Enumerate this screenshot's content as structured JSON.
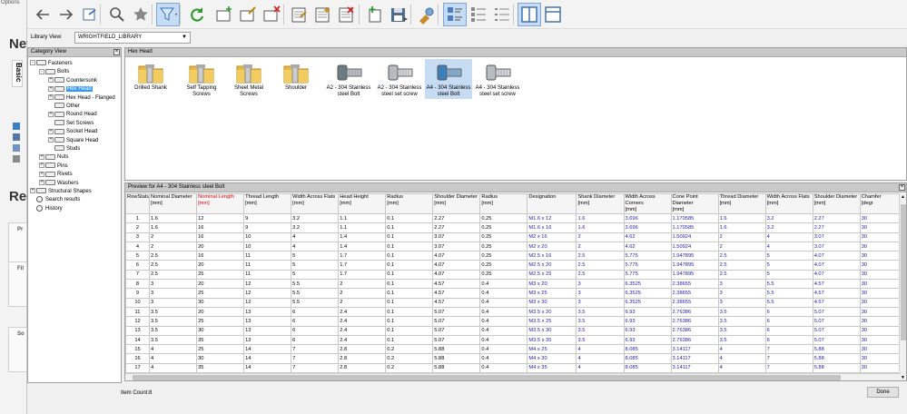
{
  "background_window": {
    "title": "Options",
    "heading_fragment": "Nev",
    "tab_label": "Basic",
    "heading_fragment_2": "Rec",
    "box_labels": [
      "Pr",
      "Fil",
      "So"
    ]
  },
  "library": {
    "label": "Library View:",
    "selected": "WRIGHTFIELD_LIBRARY"
  },
  "category_view": {
    "title": "Category View",
    "tree": [
      {
        "label": "Fasteners",
        "depth": 0,
        "expander": "-"
      },
      {
        "label": "Bolts",
        "depth": 1,
        "expander": "-"
      },
      {
        "label": "Countersunk",
        "depth": 2,
        "expander": "+"
      },
      {
        "label": "Hex Head",
        "depth": 2,
        "expander": "+",
        "selected": true
      },
      {
        "label": "Hex Head - Flanged",
        "depth": 2,
        "expander": "+"
      },
      {
        "label": "Other",
        "depth": 2,
        "expander": ""
      },
      {
        "label": "Round Head",
        "depth": 2,
        "expander": "+"
      },
      {
        "label": "Set Screws",
        "depth": 2,
        "expander": ""
      },
      {
        "label": "Socket Head",
        "depth": 2,
        "expander": "+"
      },
      {
        "label": "Square Head",
        "depth": 2,
        "expander": "+"
      },
      {
        "label": "Studs",
        "depth": 2,
        "expander": ""
      },
      {
        "label": "Nuts",
        "depth": 1,
        "expander": "+"
      },
      {
        "label": "Pins",
        "depth": 1,
        "expander": "+"
      },
      {
        "label": "Rivets",
        "depth": 1,
        "expander": "+"
      },
      {
        "label": "Washers",
        "depth": 1,
        "expander": "+"
      },
      {
        "label": "Structural Shapes",
        "depth": 0,
        "expander": "+"
      },
      {
        "label": "Search results",
        "depth": 0,
        "expander": ""
      },
      {
        "label": "History",
        "depth": 0,
        "expander": ""
      }
    ]
  },
  "thumbnails": {
    "title": "Hex Head",
    "items": [
      {
        "label": "Drilled Shank",
        "kind": "folder"
      },
      {
        "label": "Self Tapping Screws",
        "kind": "folder"
      },
      {
        "label": "Sheet Metal Screws",
        "kind": "folder"
      },
      {
        "label": "Shoulder",
        "kind": "folder"
      },
      {
        "label": "A2 - 304 Stainless steel Bolt",
        "kind": "bolt"
      },
      {
        "label": "A2 - 304 Stainless steel set screw",
        "kind": "screw"
      },
      {
        "label": "A4 - 304 Stainless steel Bolt",
        "kind": "bolt",
        "selected": true
      },
      {
        "label": "A4 - 304 Stainless steel set screw",
        "kind": "screw"
      }
    ]
  },
  "preview": {
    "title": "Preview for A4 - 304 Stainless steel Bolt",
    "columns": [
      {
        "label": "RowStatus",
        "unit": "",
        "red": false
      },
      {
        "label": "Nominal Diameter",
        "unit": "[mm]",
        "red": false
      },
      {
        "label": "Nominal Length",
        "unit": "[mm]",
        "red": true
      },
      {
        "label": "Thread Length",
        "unit": "[mm]",
        "red": false
      },
      {
        "label": "Width Across Flats",
        "unit": "[mm]",
        "red": false
      },
      {
        "label": "Head Height",
        "unit": "[mm]",
        "red": false
      },
      {
        "label": "Radius",
        "unit": "[mm]",
        "red": false
      },
      {
        "label": "Shoulder Diameter",
        "unit": "[mm]",
        "red": false
      },
      {
        "label": "Radius",
        "unit": "[mm]",
        "red": false
      },
      {
        "label": "Designation",
        "unit": "",
        "red": false
      },
      {
        "label": "Shank Diameter",
        "unit": "[mm]",
        "red": false
      },
      {
        "label": "Width Across Corners",
        "unit": "[mm]",
        "red": false
      },
      {
        "label": "Cone Point Diameter",
        "unit": "[mm]",
        "red": false
      },
      {
        "label": "Thread Diameter",
        "unit": "[mm]",
        "red": false
      },
      {
        "label": "Width Across Flats",
        "unit": "[mm]",
        "red": false
      },
      {
        "label": "Shoulder Diameter",
        "unit": "[mm]",
        "red": false
      },
      {
        "label": "Chamfer",
        "unit": "[degr",
        "red": false
      }
    ],
    "rows": [
      [
        "1",
        "1.6",
        "12",
        "9",
        "3.2",
        "1.1",
        "0.1",
        "2.27",
        "0.25",
        "M1.6 x 12",
        "1.6",
        "3.696",
        "1.170585",
        "1.6",
        "3.2",
        "2.27",
        "30"
      ],
      [
        "2",
        "1.6",
        "16",
        "9",
        "3.2",
        "1.1",
        "0.1",
        "2.27",
        "0.25",
        "M1.6 x 16",
        "1.6",
        "3.696",
        "1.170585",
        "1.6",
        "3.2",
        "2.27",
        "30"
      ],
      [
        "3",
        "2",
        "16",
        "10",
        "4",
        "1.4",
        "0.1",
        "3.07",
        "0.25",
        "M2 x 16",
        "2",
        "4.62",
        "1.50924",
        "2",
        "4",
        "3.07",
        "30"
      ],
      [
        "4",
        "2",
        "20",
        "10",
        "4",
        "1.4",
        "0.1",
        "3.07",
        "0.25",
        "M2 x 20",
        "2",
        "4.62",
        "1.50924",
        "2",
        "4",
        "3.07",
        "30"
      ],
      [
        "5",
        "2.5",
        "16",
        "11",
        "5",
        "1.7",
        "0.1",
        "4.07",
        "0.25",
        "M2.5 x 16",
        "2.5",
        "5.775",
        "1.947895",
        "2.5",
        "5",
        "4.07",
        "30"
      ],
      [
        "6",
        "2.5",
        "20",
        "11",
        "5",
        "1.7",
        "0.1",
        "4.07",
        "0.25",
        "M2.5 x 20",
        "2.5",
        "5.775",
        "1.947895",
        "2.5",
        "5",
        "4.07",
        "30"
      ],
      [
        "7",
        "2.5",
        "25",
        "11",
        "5",
        "1.7",
        "0.1",
        "4.07",
        "0.25",
        "M2.5 x 25",
        "2.5",
        "5.775",
        "1.947895",
        "2.5",
        "5",
        "4.07",
        "30"
      ],
      [
        "8",
        "3",
        "20",
        "12",
        "5.5",
        "2",
        "0.1",
        "4.57",
        "0.4",
        "M3 x 20",
        "3",
        "6.3525",
        "2.38655",
        "3",
        "5.5",
        "4.57",
        "30"
      ],
      [
        "9",
        "3",
        "25",
        "12",
        "5.5",
        "2",
        "0.1",
        "4.57",
        "0.4",
        "M3 x 25",
        "3",
        "6.3525",
        "2.38655",
        "3",
        "5.5",
        "4.57",
        "30"
      ],
      [
        "10",
        "3",
        "30",
        "12",
        "5.5",
        "2",
        "0.1",
        "4.57",
        "0.4",
        "M3 x 30",
        "3",
        "6.3525",
        "2.38655",
        "3",
        "5.5",
        "4.57",
        "30"
      ],
      [
        "11",
        "3.5",
        "20",
        "13",
        "6",
        "2.4",
        "0.1",
        "5.07",
        "0.4",
        "M3.5 x 20",
        "3.5",
        "6.93",
        "2.76386",
        "3.5",
        "6",
        "5.07",
        "30"
      ],
      [
        "12",
        "3.5",
        "25",
        "13",
        "6",
        "2.4",
        "0.1",
        "5.07",
        "0.4",
        "M3.5 x 25",
        "3.5",
        "6.93",
        "2.76386",
        "3.5",
        "6",
        "5.07",
        "30"
      ],
      [
        "13",
        "3.5",
        "30",
        "13",
        "6",
        "2.4",
        "0.1",
        "5.07",
        "0.4",
        "M3.5 x 30",
        "3.5",
        "6.93",
        "2.76386",
        "3.5",
        "6",
        "5.07",
        "30"
      ],
      [
        "14",
        "3.5",
        "35",
        "13",
        "6",
        "2.4",
        "0.1",
        "5.07",
        "0.4",
        "M3.5 x 35",
        "3.5",
        "6.93",
        "2.76386",
        "3.5",
        "6",
        "5.07",
        "30"
      ],
      [
        "15",
        "4",
        "25",
        "14",
        "7",
        "2.8",
        "0.2",
        "5.88",
        "0.4",
        "M4 x 25",
        "4",
        "8.085",
        "3.14117",
        "4",
        "7",
        "5.88",
        "30"
      ],
      [
        "16",
        "4",
        "30",
        "14",
        "7",
        "2.8",
        "0.2",
        "5.88",
        "0.4",
        "M4 x 30",
        "4",
        "8.085",
        "3.14117",
        "4",
        "7",
        "5.88",
        "30"
      ],
      [
        "17",
        "4",
        "35",
        "14",
        "7",
        "2.8",
        "0.2",
        "5.88",
        "0.4",
        "M4 x 35",
        "4",
        "8.085",
        "3.14117",
        "4",
        "7",
        "5.88",
        "30"
      ]
    ]
  },
  "status": {
    "item_count": "Item Count:8",
    "done_label": "Done"
  },
  "toolbar": [
    {
      "name": "back-arrow-icon"
    },
    {
      "name": "forward-arrow-icon"
    },
    {
      "name": "refresh-page-icon"
    },
    {
      "name": "search-icon"
    },
    {
      "name": "favorite-star-icon"
    },
    {
      "name": "filter-icon",
      "active": true
    },
    {
      "name": "reload-icon"
    },
    {
      "name": "new-category-icon"
    },
    {
      "name": "edit-category-icon"
    },
    {
      "name": "delete-category-icon"
    },
    {
      "name": "new-item-icon"
    },
    {
      "name": "edit-item-icon"
    },
    {
      "name": "delete-item-icon"
    },
    {
      "name": "add-to-library-icon"
    },
    {
      "name": "save-icon"
    },
    {
      "name": "properties-icon"
    },
    {
      "name": "large-icons-view-icon",
      "active": true
    },
    {
      "name": "list-view-icon"
    },
    {
      "name": "details-view-icon"
    },
    {
      "name": "split-view-icon",
      "active": true
    },
    {
      "name": "single-pane-icon"
    }
  ],
  "colors": {
    "selection": "#3399ff",
    "key_column_header": "#e00000",
    "value_text": "#1a1aa8",
    "active_toolbar": "#c5dcf4",
    "icon_green": "#2e9a2e",
    "icon_red": "#d42020"
  }
}
